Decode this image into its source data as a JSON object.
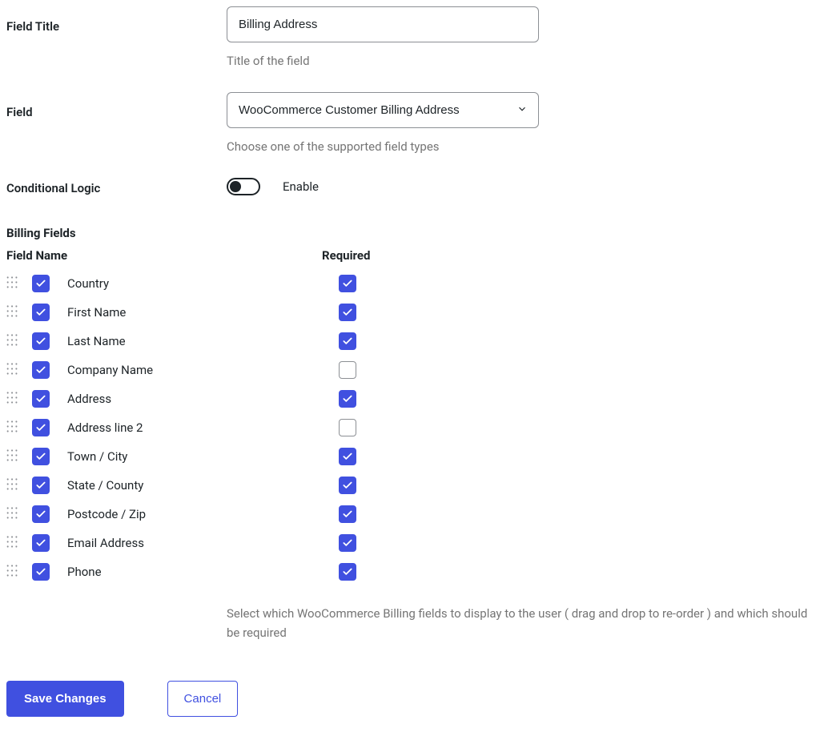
{
  "form": {
    "field_title": {
      "label": "Field Title",
      "value": "Billing Address",
      "helper": "Title of the field"
    },
    "field_select": {
      "label": "Field",
      "value": "WooCommerce Customer Billing Address",
      "helper": "Choose one of the supported field types"
    },
    "conditional_logic": {
      "label": "Conditional Logic",
      "enable_label": "Enable"
    }
  },
  "billing_fields": {
    "section_title": "Billing Fields",
    "header_name": "Field Name",
    "header_required": "Required",
    "helper": "Select which WooCommerce Billing fields to display to the user ( drag and drop to re-order ) and which should be required",
    "rows": [
      {
        "name": "Country",
        "enabled": true,
        "required": true
      },
      {
        "name": "First Name",
        "enabled": true,
        "required": true
      },
      {
        "name": "Last Name",
        "enabled": true,
        "required": true
      },
      {
        "name": "Company Name",
        "enabled": true,
        "required": false
      },
      {
        "name": "Address",
        "enabled": true,
        "required": true
      },
      {
        "name": "Address line 2",
        "enabled": true,
        "required": false
      },
      {
        "name": "Town / City",
        "enabled": true,
        "required": true
      },
      {
        "name": "State / County",
        "enabled": true,
        "required": true
      },
      {
        "name": "Postcode / Zip",
        "enabled": true,
        "required": true
      },
      {
        "name": "Email Address",
        "enabled": true,
        "required": true
      },
      {
        "name": "Phone",
        "enabled": true,
        "required": true
      }
    ]
  },
  "buttons": {
    "save": "Save Changes",
    "cancel": "Cancel"
  }
}
